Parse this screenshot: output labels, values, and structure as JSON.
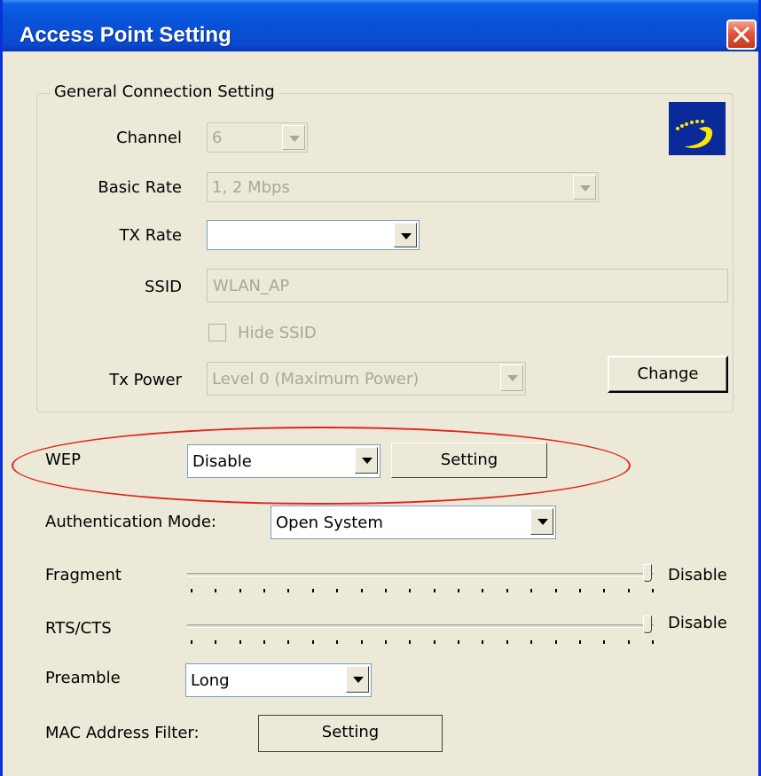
{
  "window": {
    "title": "Access Point Setting"
  },
  "general": {
    "legend": "General Connection Setting",
    "channel": {
      "label": "Channel",
      "value": "6"
    },
    "basic_rate": {
      "label": "Basic Rate",
      "value": "1, 2 Mbps"
    },
    "tx_rate": {
      "label": "TX Rate",
      "value": ""
    },
    "ssid": {
      "label": "SSID",
      "value": "WLAN_AP"
    },
    "hide_ssid": {
      "label": "Hide SSID",
      "checked": false
    },
    "tx_power": {
      "label": "Tx Power",
      "value": "Level 0 (Maximum Power)"
    },
    "change_button": "Change"
  },
  "wep": {
    "label": "WEP",
    "value": "Disable",
    "setting_button": "Setting"
  },
  "auth": {
    "label": "Authentication Mode:",
    "value": "Open System"
  },
  "fragment": {
    "label": "Fragment",
    "value_label": "Disable",
    "level": 1.0
  },
  "rts_cts": {
    "label": "RTS/CTS",
    "value_label": "Disable",
    "level": 1.0
  },
  "preamble": {
    "label": "Preamble",
    "value": "Long"
  },
  "mac_filter": {
    "label": "MAC Address Filter:",
    "setting_button": "Setting"
  },
  "icons": [
    "close-icon",
    "wireless-logo-icon",
    "dropdown-arrow-icon"
  ],
  "colors": {
    "titlebar": "#0753D8",
    "dialog_bg": "#ECE9D8",
    "highlight_ellipse": "#E0251B",
    "close_button": "#E2563A"
  }
}
